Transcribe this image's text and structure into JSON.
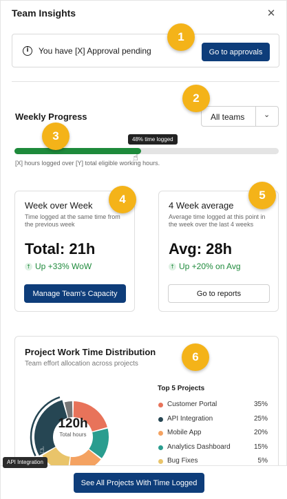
{
  "header": {
    "title": "Team Insights",
    "close_icon": "close-icon",
    "close_glyph": "✕"
  },
  "alert": {
    "icon": "info-icon",
    "icon_glyph": "i",
    "message": "You have [X] Approval pending",
    "button": "Go to approvals"
  },
  "weekly_progress": {
    "title": "Weekly Progress",
    "team_select": {
      "selected": "All teams",
      "chevron": "⌄"
    },
    "progress_fraction": 0.48,
    "tooltip": "48% time logged",
    "caption": "[X] hours logged over [Y] total eligible working hours."
  },
  "cards": [
    {
      "title": "Week over Week",
      "subtitle": "Time logged at the same time from the previous week",
      "value": "Total: 21h",
      "trend": "Up +33% WoW",
      "trend_arrow": "↑",
      "button": "Manage Team's Capacity"
    },
    {
      "title": "4 Week average",
      "subtitle": "Average time logged at this point in the week over the last 4 weeks",
      "value": "Avg: 28h",
      "trend": "Up +20% on Avg",
      "trend_arrow": "↑",
      "button": "Go to reports"
    }
  ],
  "distribution": {
    "title": "Project Work Time Distribution",
    "subtitle": "Team effort allocation across projects",
    "total_value": "120h",
    "total_label": "Total hours",
    "top_label": "Top 5 Projects",
    "projects": [
      {
        "name": "Customer Portal",
        "pct": "35%",
        "value": 35,
        "color": "#e8735a"
      },
      {
        "name": "API Integration",
        "pct": "25%",
        "value": 25,
        "color": "#264653"
      },
      {
        "name": "Mobile App",
        "pct": "20%",
        "value": 20,
        "color": "#f4a261"
      },
      {
        "name": "Analytics Dashboard",
        "pct": "15%",
        "value": 15,
        "color": "#2a9d8f"
      },
      {
        "name": "Bug Fixes",
        "pct": "5%",
        "value": 5,
        "color": "#e9c46a"
      }
    ],
    "donut_order": [
      {
        "value": 20,
        "color": "#e8735a"
      },
      {
        "value": 14,
        "color": "#2a9d8f"
      },
      {
        "value": 16,
        "color": "#f4a261"
      },
      {
        "value": 14,
        "color": "#e9c46a"
      },
      {
        "value": 28,
        "color": "#264653"
      },
      {
        "value": 4,
        "color": "#777777"
      }
    ],
    "hover_tooltip": "API Integration"
  },
  "footer": {
    "button": "See All Projects With Time Logged"
  },
  "badges": [
    "1",
    "2",
    "3",
    "4",
    "5",
    "6"
  ],
  "colors": {
    "primary": "#0e3d7a",
    "success": "#1e8a3b",
    "badge": "#f4b319"
  }
}
